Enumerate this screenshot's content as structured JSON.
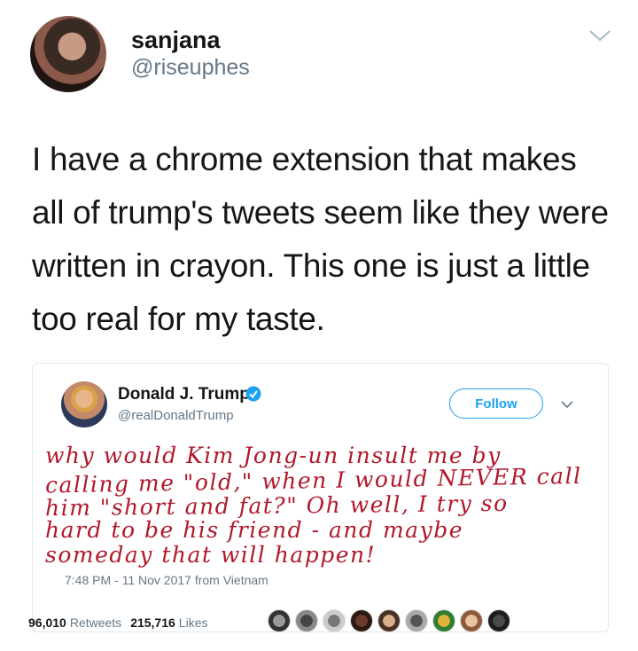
{
  "tweet": {
    "display_name": "sanjana",
    "handle": "@riseuphes",
    "text": "I have a chrome extension that makes all of trump's tweets seem like they were written in crayon. This one is just a little too real for my taste."
  },
  "quoted_tweet": {
    "display_name": "Donald J. Trump",
    "handle": "@realDonaldTrump",
    "follow_label": "Follow",
    "crayon_lines": [
      "why would Kim Jong-un insult me by",
      "calling me \"old,\" when I would NEVER call",
      "him \"short and fat?\" Oh well, I try so",
      "hard to be his friend - and maybe",
      "someday that will happen!"
    ],
    "meta": {
      "timestamp": "7:48 PM - 11 Nov 2017",
      "from_label": "from",
      "location": "Vietnam"
    },
    "stats": {
      "retweets_count": "96,010",
      "retweets_label": "Retweets",
      "likes_count": "215,716",
      "likes_label": "Likes"
    }
  },
  "colors": {
    "accent": "#1da1f2",
    "crayon": "#b0182b",
    "muted": "#657786",
    "text": "#14171a"
  },
  "icons": {
    "dropdown": "chevron-down-icon",
    "verified": "verified-badge-icon"
  }
}
